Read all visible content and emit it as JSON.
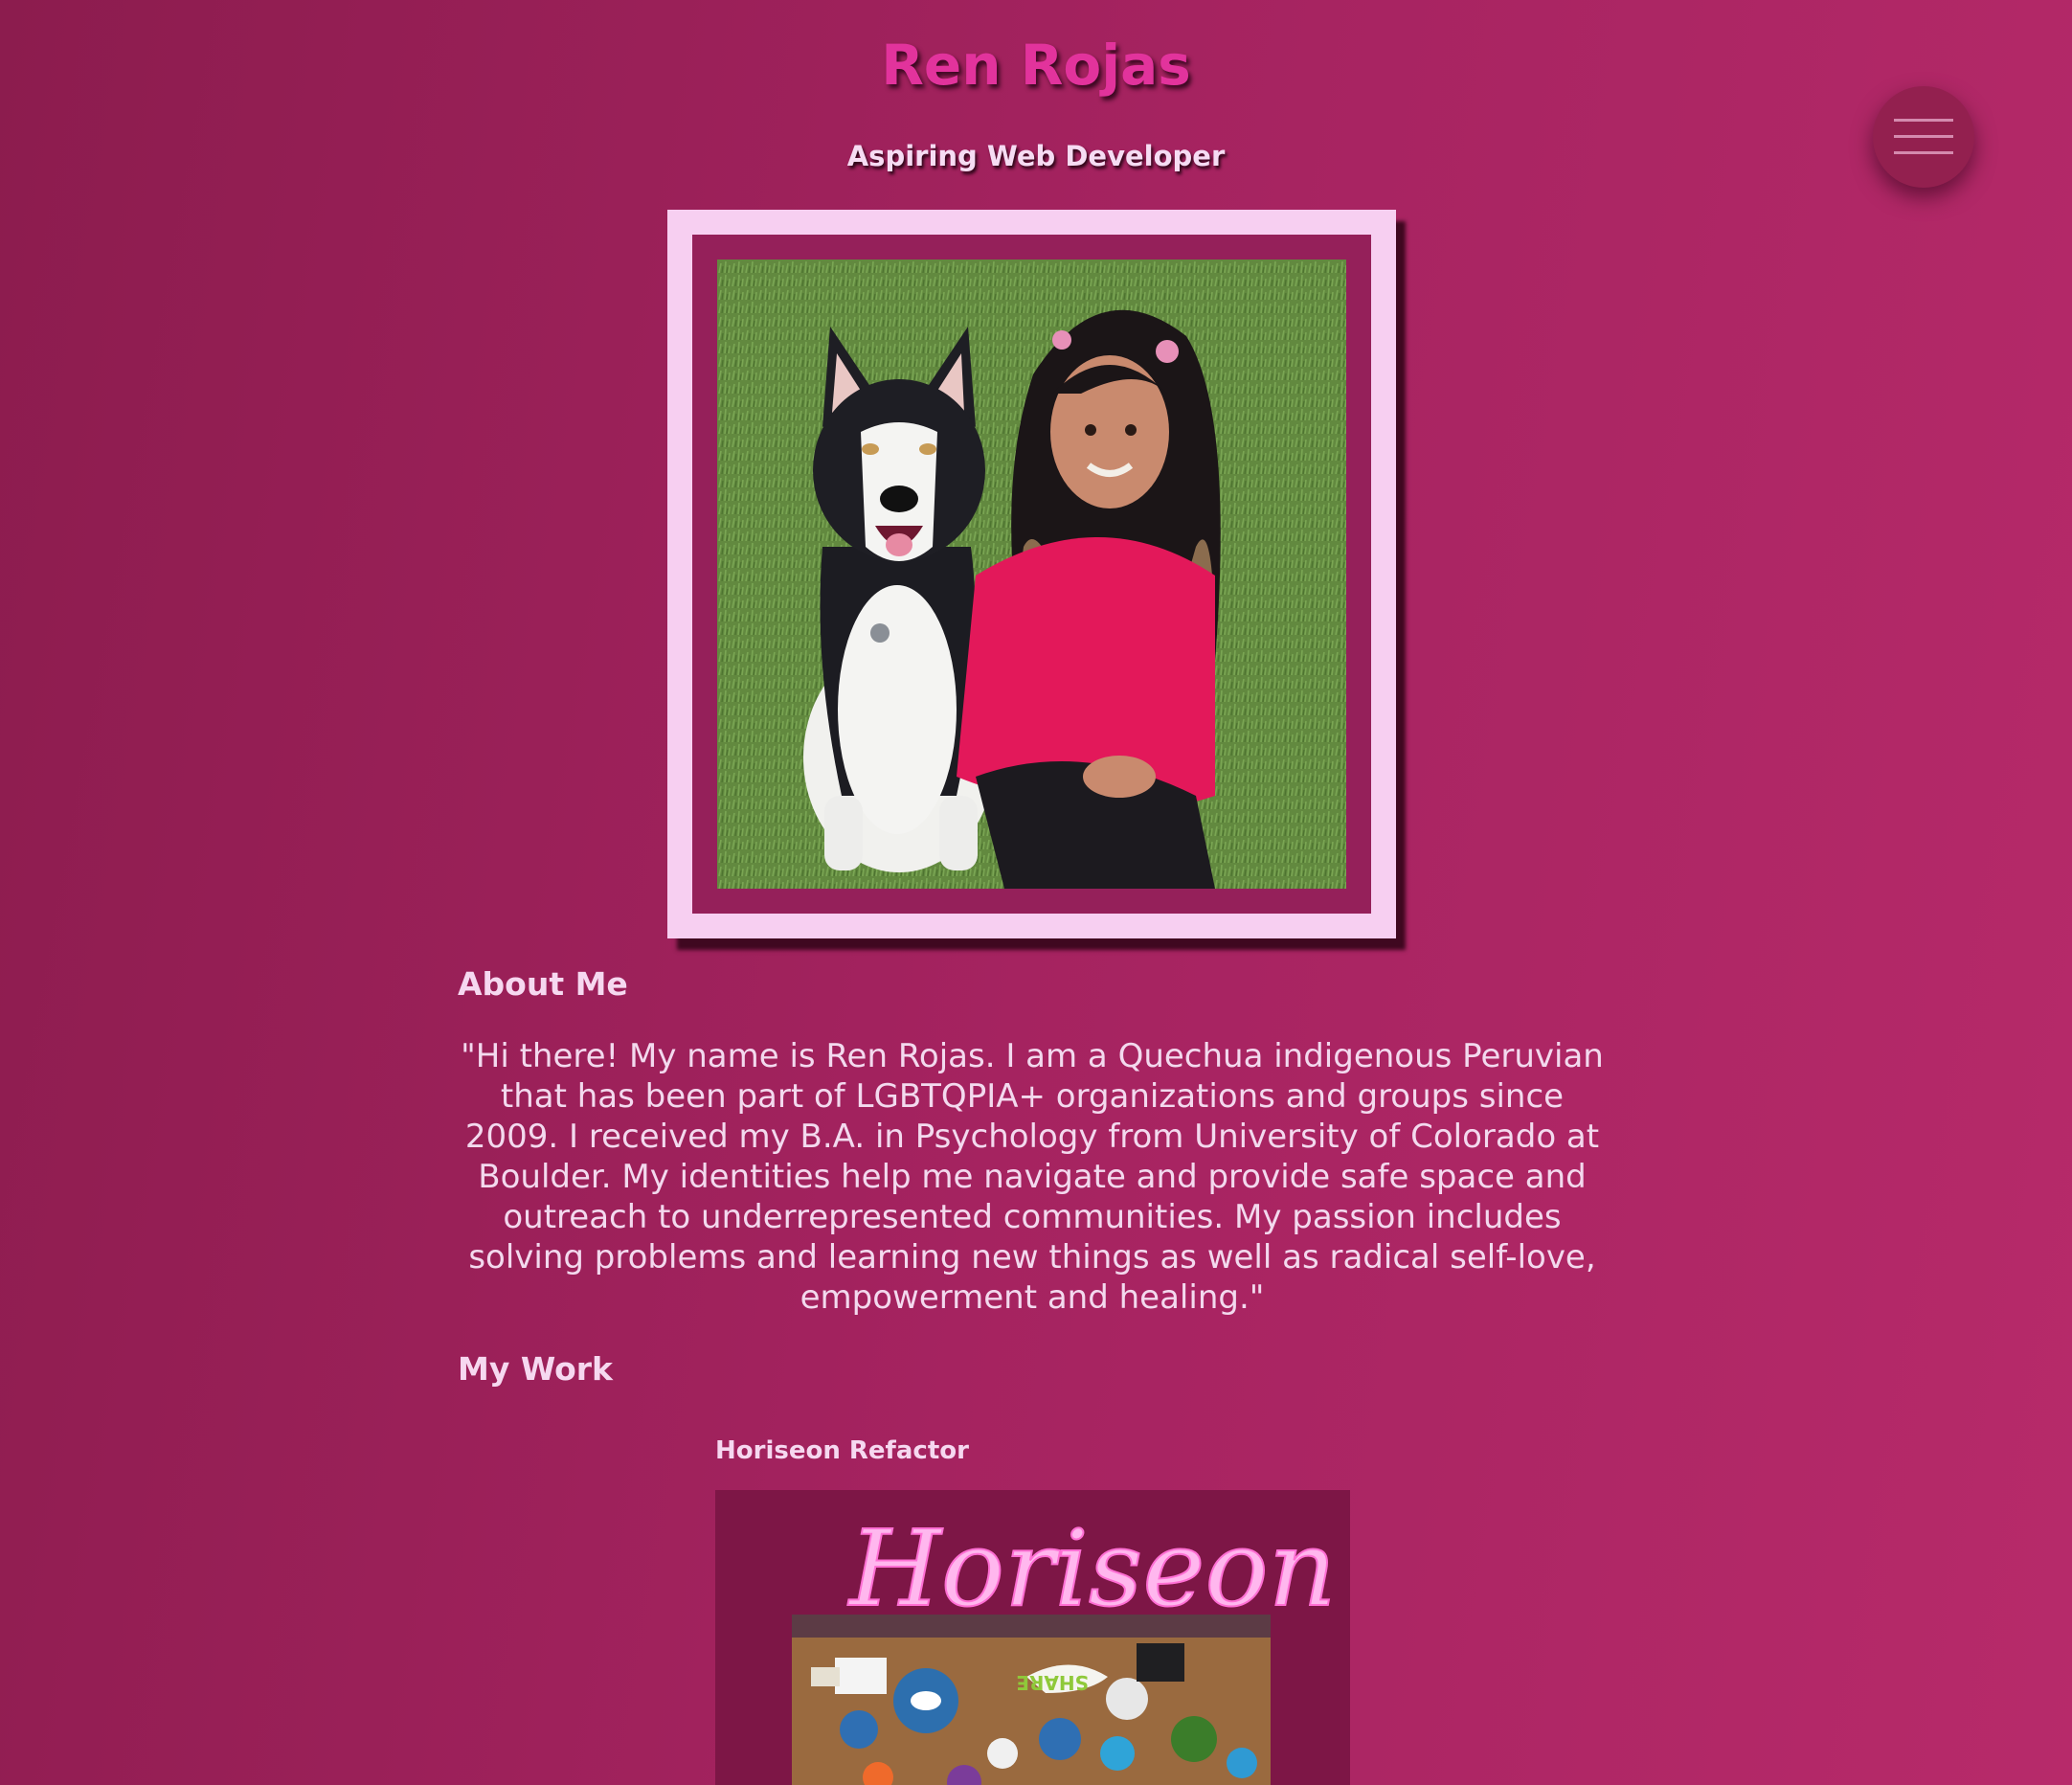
{
  "header": {
    "name": "Ren Rojas",
    "subtitle": "Aspiring Web Developer"
  },
  "profile_photo": {
    "alt": "Ren Rojas with husky dog"
  },
  "about": {
    "heading": "About Me",
    "text": "\"Hi there! My name is Ren Rojas. I am a Quechua indigenous Peruvian that has been part of LGBTQPIA+ organizations and groups since 2009. I received my B.A. in Psychology from University of Colorado at Boulder. My identities help me navigate and provide safe space and outreach to underrepresented communities. My passion includes solving problems and learning new things as well as radical self-love, empowerment and healing.\""
  },
  "work": {
    "heading": "My Work",
    "projects": [
      {
        "title": "Horiseon Refactor",
        "logo_text": "Horiseon",
        "share_text": "SHARE"
      }
    ]
  },
  "colors": {
    "background": "#a52360",
    "title": "#e2339c",
    "frame": "#f7cff1",
    "frame_inner": "#95205a",
    "logo_neon": "#ff8fe0"
  },
  "icons": {
    "menu": "hamburger-menu-icon"
  }
}
